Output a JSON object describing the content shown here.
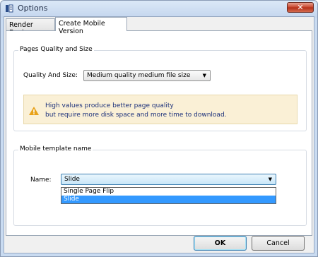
{
  "window": {
    "title": "Options",
    "close_symbol": "✕"
  },
  "tabs": [
    {
      "label": "Render Engine",
      "active": false
    },
    {
      "label": "Create Mobile Version",
      "active": true
    }
  ],
  "quality_group": {
    "title": "Pages Quality and Size",
    "field_label": "Quality And Size:",
    "selected": "Medium quality medium file size",
    "notice_line1": "High values produce better page quality",
    "notice_line2": "but require more disk space and more time to download."
  },
  "template_group": {
    "title": "Mobile template name",
    "field_label": "Name:",
    "selected": "Slide",
    "options": [
      "Single Page Flip",
      "Slide"
    ],
    "highlighted_option": "Slide"
  },
  "buttons": {
    "ok": "OK",
    "cancel": "Cancel"
  },
  "colors": {
    "accent": "#3399ff",
    "notice_bg": "#faf0d6",
    "notice_text": "#1a2f7a"
  }
}
